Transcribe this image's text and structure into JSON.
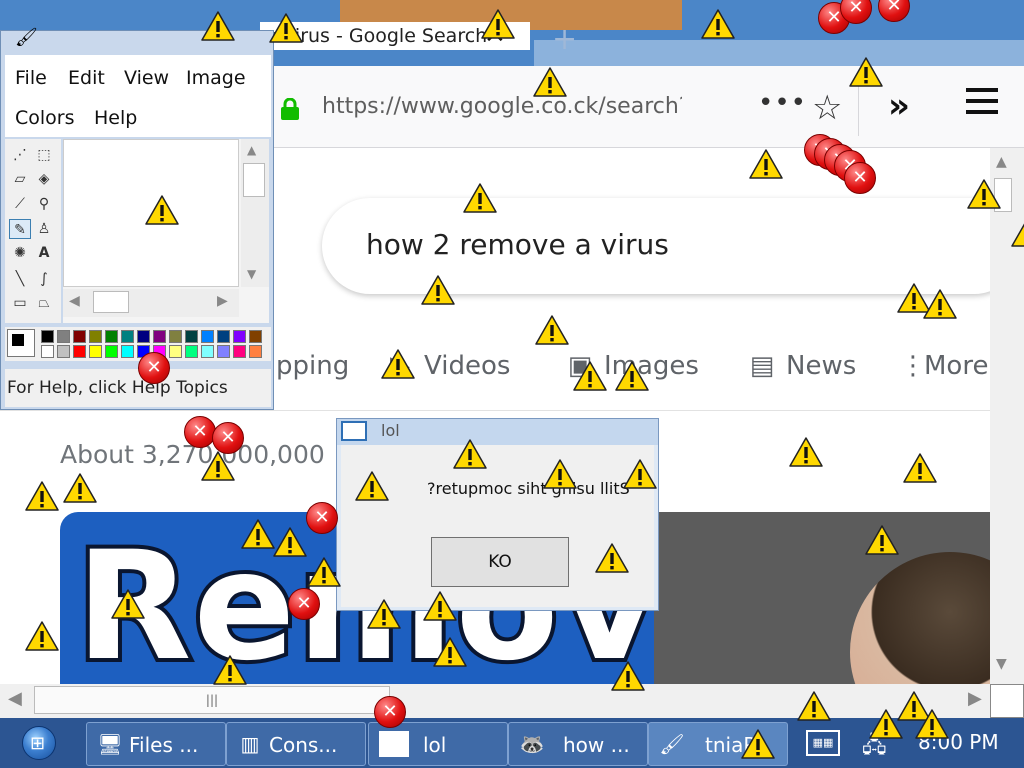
{
  "browser": {
    "tab_title": "a virus - Google Search",
    "tab_close_glyph": "✕",
    "new_tab_glyph": "+",
    "url": "https://www.google.co.ck/search?q",
    "search_query": "how 2 remove a virus",
    "nav_tabs": [
      {
        "label": "pping",
        "icon": "shopping-icon"
      },
      {
        "label": "Videos",
        "icon": "videos-icon"
      },
      {
        "label": "Images",
        "icon": "images-icon"
      },
      {
        "label": "News",
        "icon": "news-icon"
      },
      {
        "label": "More",
        "icon": "more-icon"
      }
    ],
    "results_count": "About 3,270,000,000",
    "image_result_text": "Remove"
  },
  "paint": {
    "menu": [
      "File",
      "Edit",
      "View",
      "Image",
      "Colors",
      "Help"
    ],
    "status": "For Help, click Help Topics",
    "palette": [
      "#000000",
      "#808080",
      "#800000",
      "#808000",
      "#008000",
      "#008080",
      "#000080",
      "#800080",
      "#808040",
      "#004040",
      "#0080ff",
      "#004080",
      "#8000ff",
      "#804000",
      "#ffffff",
      "#c0c0c0",
      "#ff0000",
      "#ffff00",
      "#00ff00",
      "#00ffff",
      "#0000ff",
      "#ff00ff",
      "#ffff80",
      "#00ff80",
      "#80ffff",
      "#8080ff",
      "#ff0080",
      "#ff8040"
    ]
  },
  "dialog": {
    "title": "lol",
    "message": "?retupmoc siht gnisu llitS",
    "button": "KO"
  },
  "taskbar": {
    "items": [
      {
        "label": "Files ...",
        "icon": "files-icon"
      },
      {
        "label": "Cons...",
        "icon": "console-icon"
      },
      {
        "label": "lol",
        "icon": "window-icon"
      },
      {
        "label": "how ...",
        "icon": "browser-icon"
      },
      {
        "label": "tniaP",
        "icon": "paint-icon"
      }
    ],
    "clock": "8:00 PM"
  },
  "colors": {
    "warning_yellow": "#ffd800",
    "error_red": "#e01010",
    "taskbar": "#2c5592"
  }
}
